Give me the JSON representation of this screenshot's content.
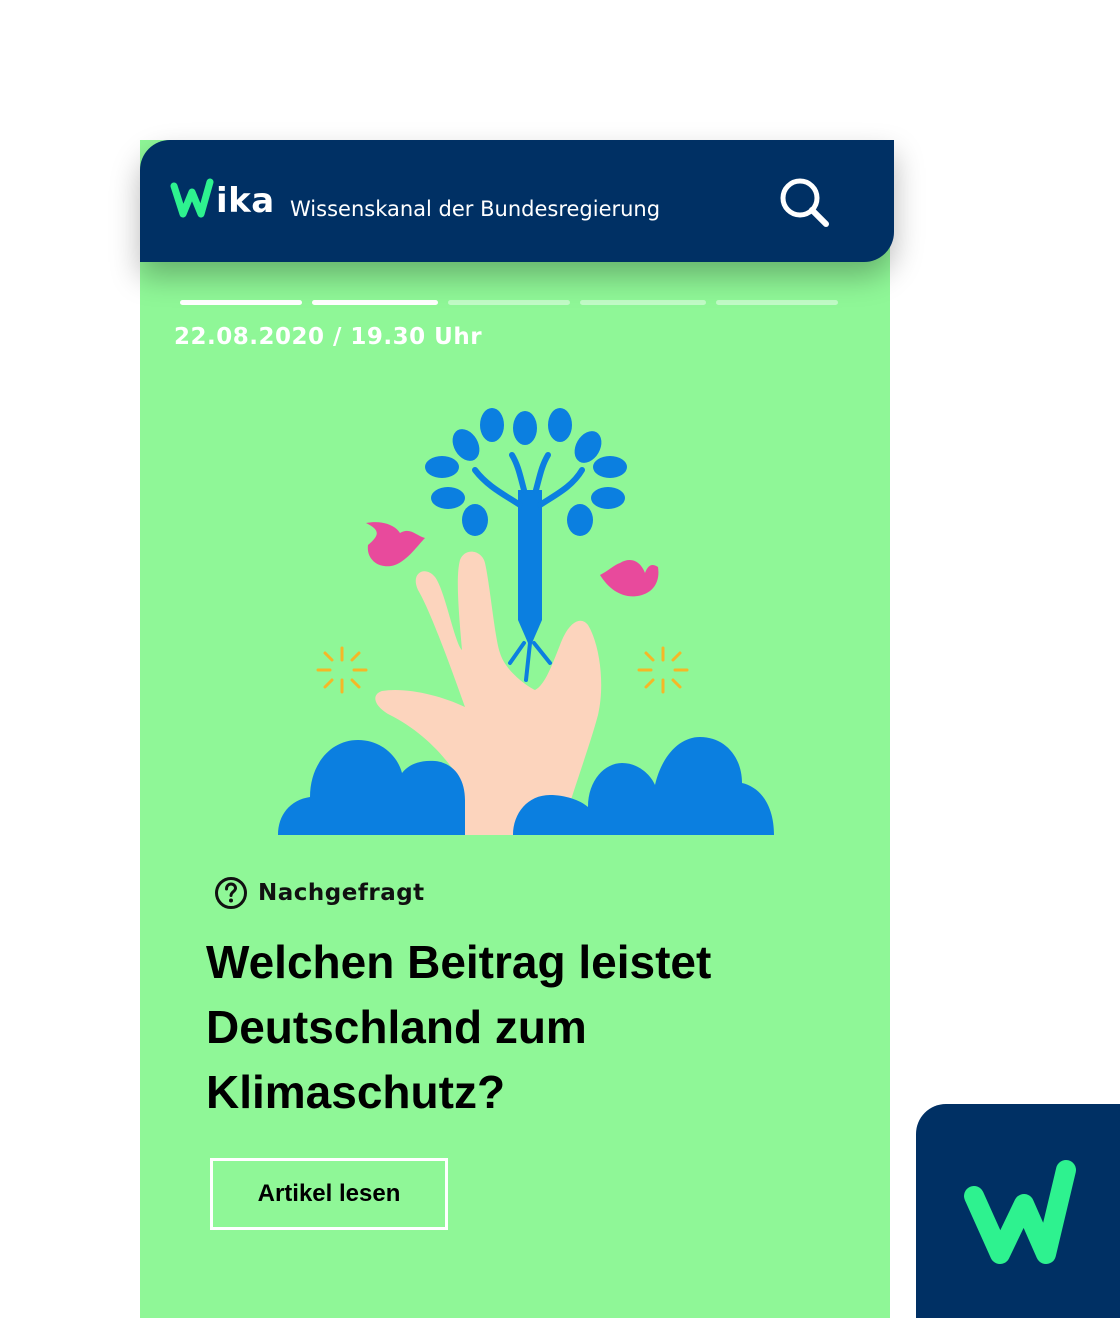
{
  "header": {
    "logo_text": "ika",
    "tagline": "Wissenskanal der Bundesregierung",
    "search_icon": "search-icon"
  },
  "story": {
    "progress": {
      "total_segments": 5,
      "completed_segments": 2
    },
    "date": "22.08.2020 / 19.30 Uhr",
    "category": "Nachgefragt",
    "category_icon": "question-circle-icon",
    "headline": "Welchen Beitrag leistet Deutschland zum Klimaschutz?",
    "cta_label": "Artikel lesen"
  },
  "colors": {
    "navy": "#003064",
    "brand_green": "#2ef28f",
    "card_green": "#8ff797",
    "tree_blue": "#0b7fe0",
    "bird_pink": "#e84a9c",
    "hand_skin": "#fcd4bd",
    "sparkle_yellow": "#f5b726"
  }
}
